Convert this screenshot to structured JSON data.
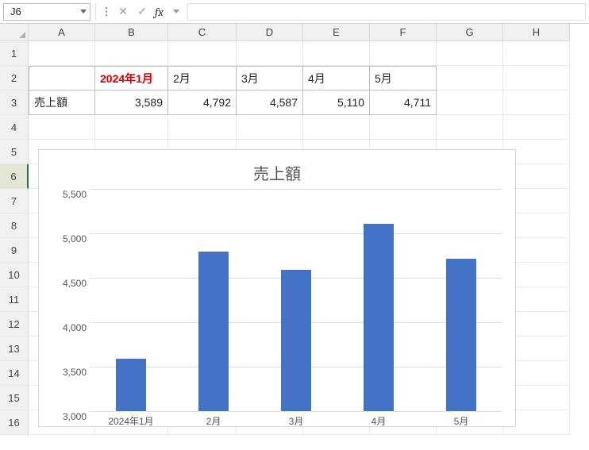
{
  "name_box": {
    "value": "J6"
  },
  "formula_bar": {
    "value": "",
    "fx_label": "fx"
  },
  "grid": {
    "columns": [
      "A",
      "B",
      "C",
      "D",
      "E",
      "F",
      "G",
      "H"
    ],
    "rows": [
      "1",
      "2",
      "3",
      "4",
      "5",
      "6",
      "7",
      "8",
      "9",
      "10",
      "11",
      "12",
      "13",
      "14",
      "15",
      "16"
    ],
    "active_row": "6",
    "A3": "売上額",
    "B2": "2024年1月",
    "C2": "2月",
    "D2": "3月",
    "E2": "4月",
    "F2": "5月",
    "B3": "3,589",
    "C3": "4,792",
    "D3": "4,587",
    "E3": "5,110",
    "F3": "4,711"
  },
  "chart_data": {
    "type": "bar",
    "title": "売上額",
    "categories": [
      "2024年1月",
      "2月",
      "3月",
      "4月",
      "5月"
    ],
    "values": [
      3589,
      4792,
      4587,
      5110,
      4711
    ],
    "xlabel": "",
    "ylabel": "",
    "ylim": [
      3000,
      5500
    ],
    "yticks": [
      3000,
      3500,
      4000,
      4500,
      5000,
      5500
    ]
  }
}
